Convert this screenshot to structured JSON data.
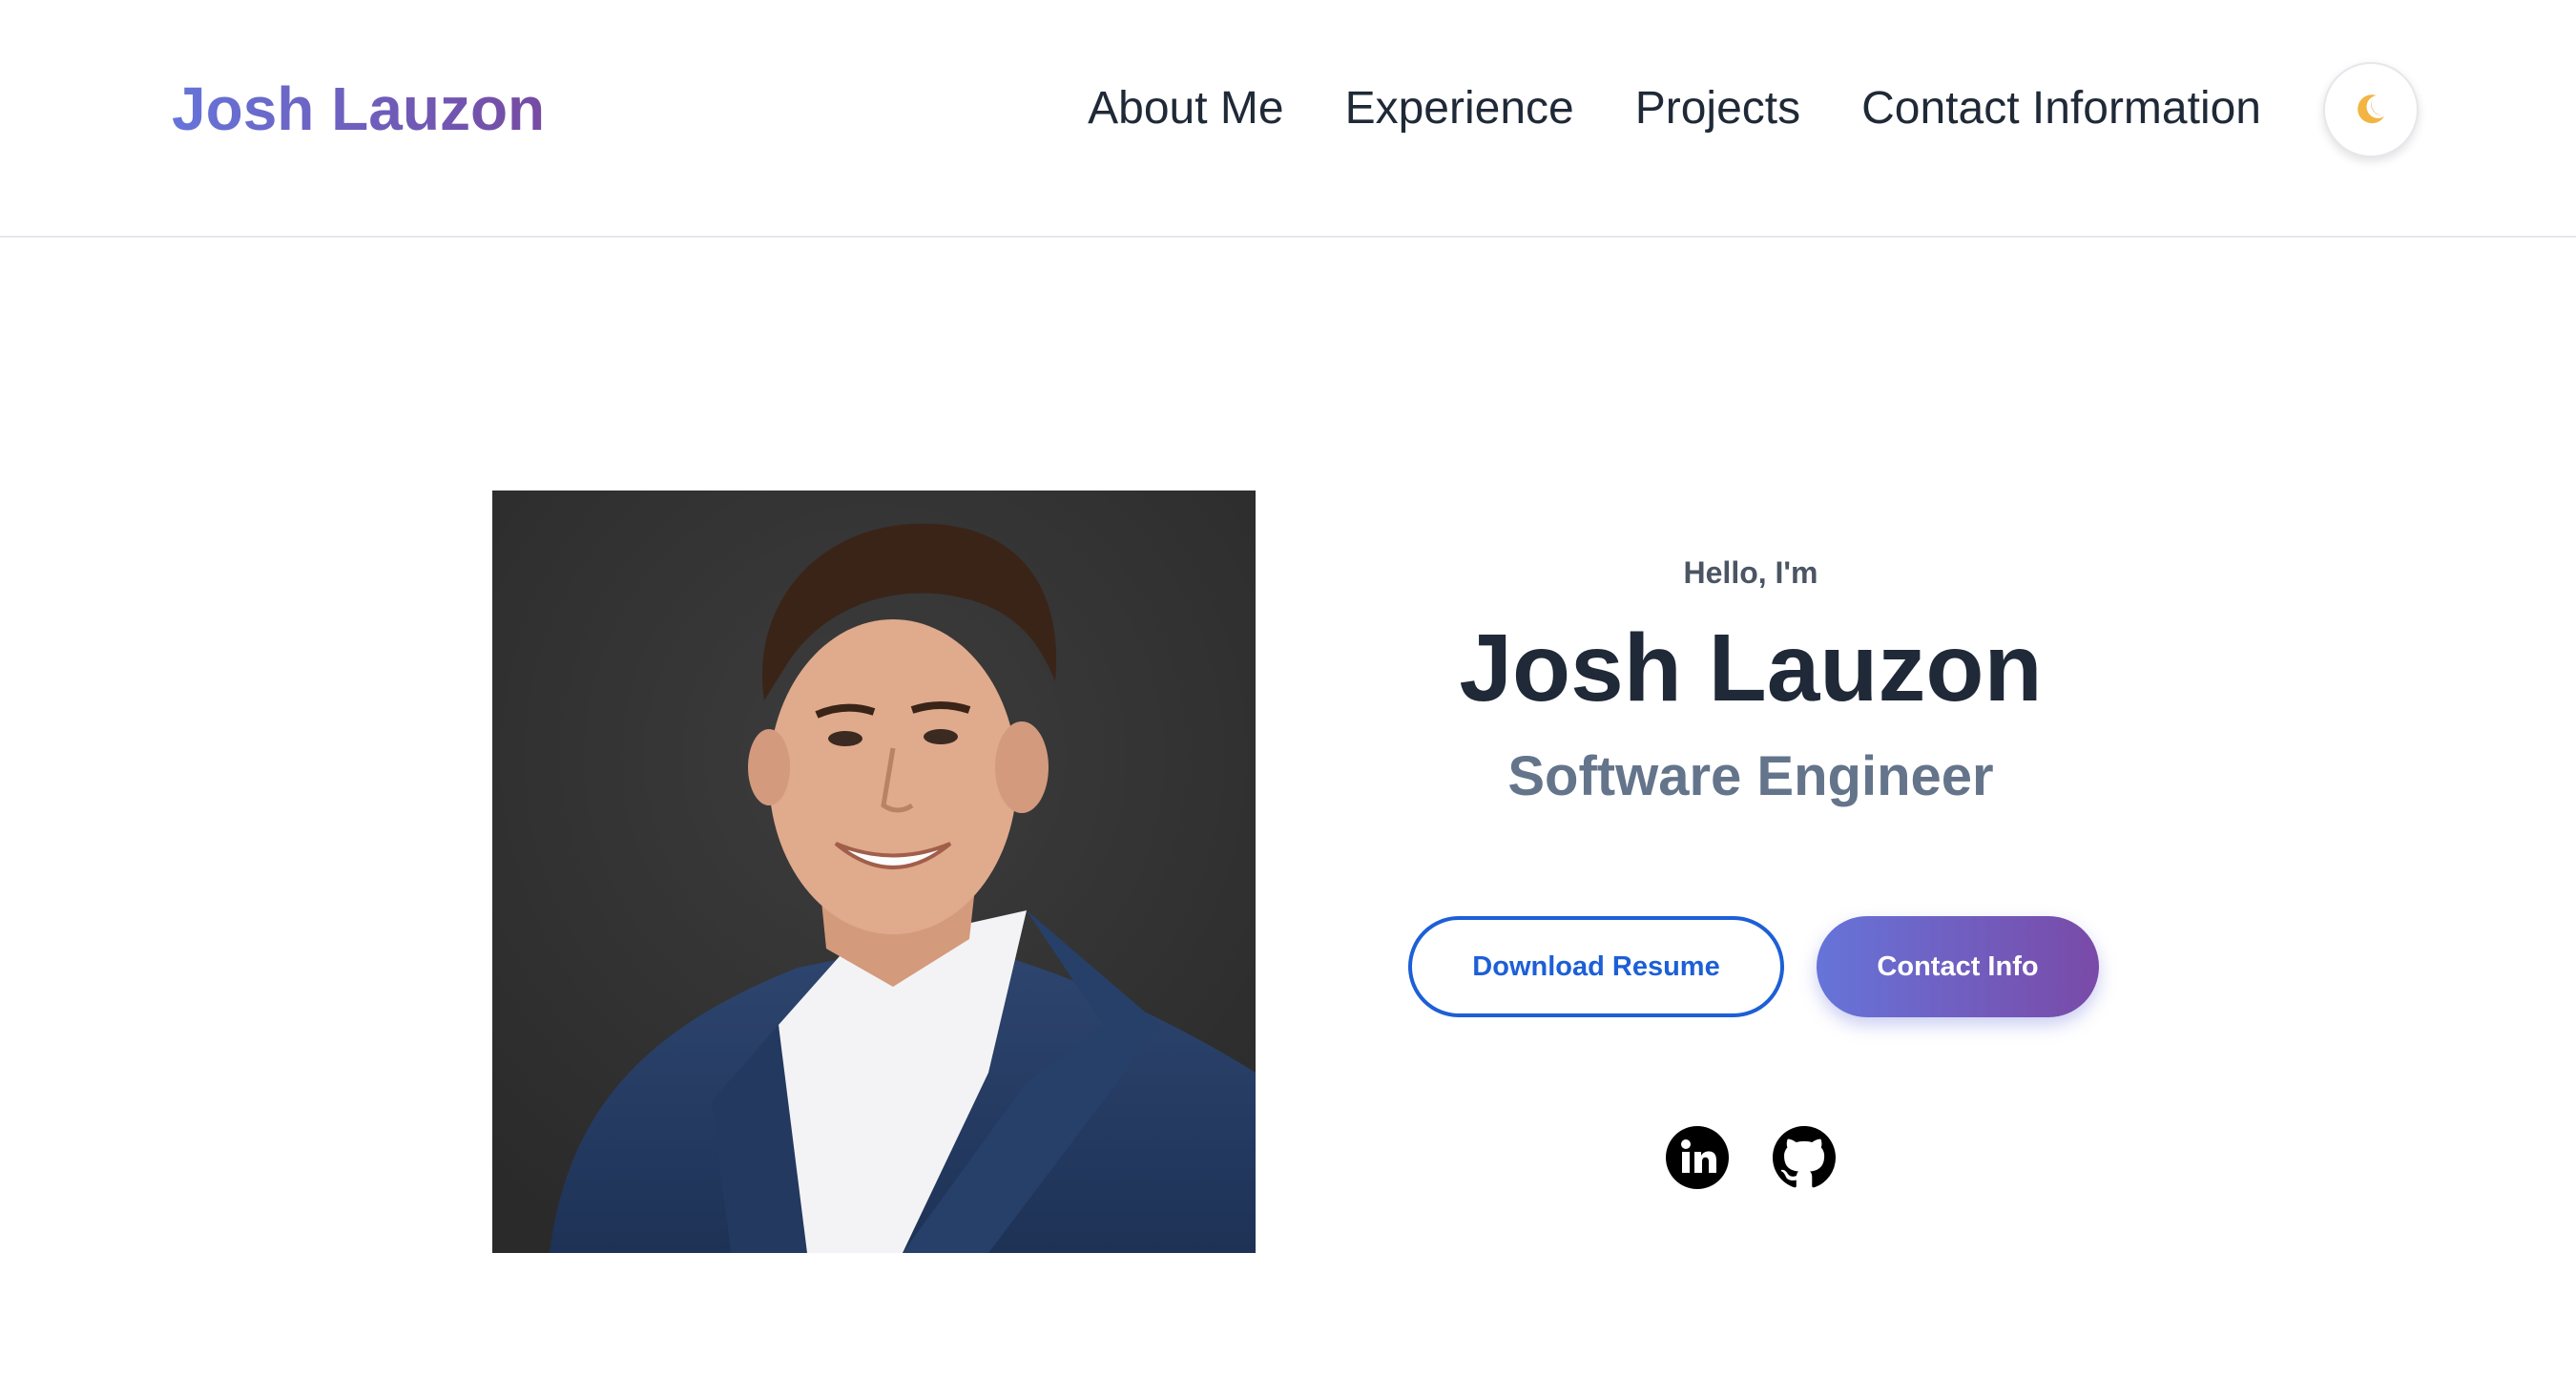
{
  "header": {
    "brand": "Josh Lauzon",
    "nav": [
      "About Me",
      "Experience",
      "Projects",
      "Contact Information"
    ],
    "theme_toggle_icon": "moon-icon"
  },
  "hero": {
    "photo_icon": "profile-photo",
    "greeting": "Hello, I'm",
    "name": "Josh Lauzon",
    "title": "Software Engineer",
    "buttons": {
      "resume": "Download Resume",
      "contact": "Contact Info"
    },
    "socials": [
      "linkedin-icon",
      "github-icon"
    ]
  },
  "colors": {
    "accent_blue": "#1d5fd6",
    "gradient_start": "#6674d9",
    "gradient_end": "#764ba2",
    "text_dark": "#1f2937",
    "text_muted": "#64748b"
  }
}
